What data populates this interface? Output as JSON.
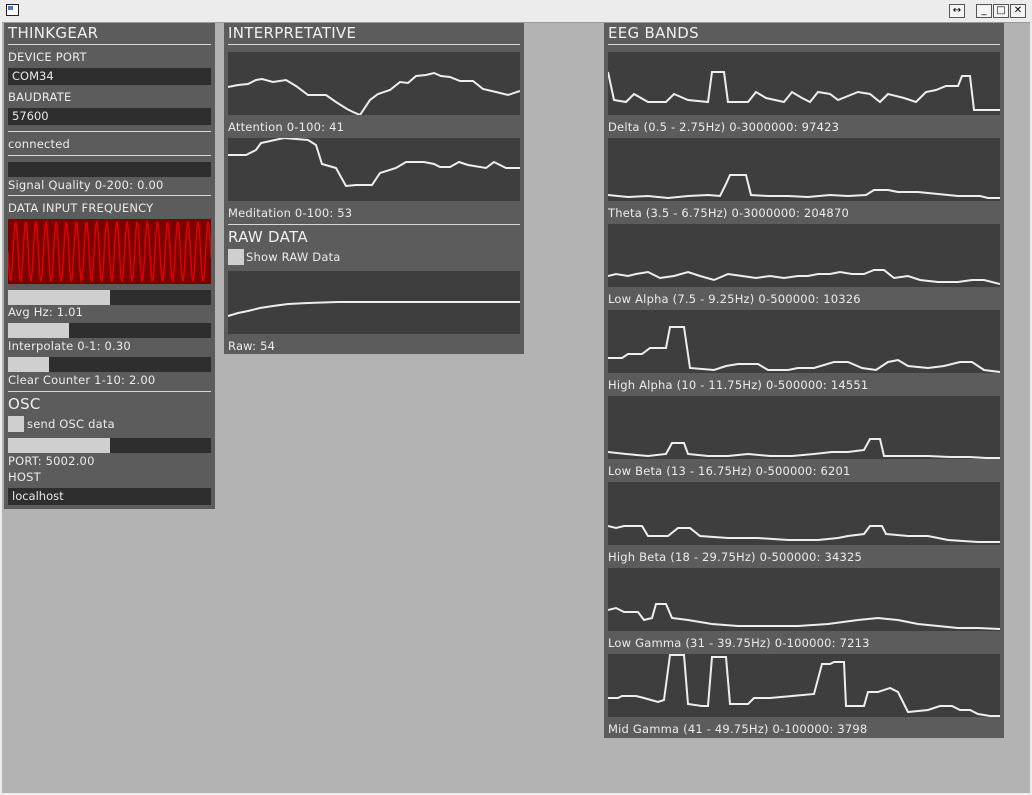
{
  "window": {
    "max_btns": [
      "↔",
      "_",
      "□",
      "✕"
    ]
  },
  "thinkgear": {
    "title": "THINKGEAR",
    "device_port_label": "DEVICE PORT",
    "device_port_value": "COM34",
    "baudrate_label": "BAUDRATE",
    "baudrate_value": "57600",
    "status": "connected",
    "signal_quality_label": "Signal Quality 0-200: 0.00",
    "data_input_frequency_label": "DATA INPUT FREQUENCY",
    "avg_hz_label": "Avg Hz: 1.01",
    "avg_hz_level": 0.5,
    "interpolate_label": "Interpolate 0-1: 0.30",
    "interpolate_level": 0.3,
    "clear_counter_label": "Clear Counter 1-10: 2.00",
    "clear_counter_level": 0.2,
    "signal_quality_level": 0.0
  },
  "osc": {
    "title": "OSC",
    "send_label": "send OSC data",
    "port_label": "PORT: 5002.00",
    "port_level": 0.5,
    "host_label": "HOST",
    "host_value": "localhost"
  },
  "interpretative": {
    "title": "INTERPRETATIVE",
    "attention_label": "Attention 0-100: 41",
    "meditation_label": "Meditation 0-100: 53"
  },
  "raw": {
    "title": "RAW DATA",
    "show_label": "Show RAW Data",
    "raw_label": "Raw: 54"
  },
  "eeg": {
    "title": "EEG BANDS",
    "bands": [
      {
        "label": "Delta (0.5 - 2.75Hz) 0-3000000: 97423"
      },
      {
        "label": "Theta (3.5 - 6.75Hz) 0-3000000: 204870"
      },
      {
        "label": "Low Alpha (7.5 - 9.25Hz) 0-500000: 10326"
      },
      {
        "label": "High Alpha (10 - 11.75Hz) 0-500000: 14551"
      },
      {
        "label": "Low Beta (13 - 16.75Hz) 0-500000: 6201"
      },
      {
        "label": "High Beta (18 - 29.75Hz) 0-500000: 34325"
      },
      {
        "label": "Low Gamma (31 - 39.75Hz) 0-100000: 7213"
      },
      {
        "label": "Mid Gamma (41 - 49.75Hz) 0-100000: 3798"
      }
    ]
  },
  "colors": {
    "panel": "#5c5c5c",
    "graph": "#3e3e3e",
    "line": "#eeeeee",
    "freq_red": "#e00000"
  }
}
